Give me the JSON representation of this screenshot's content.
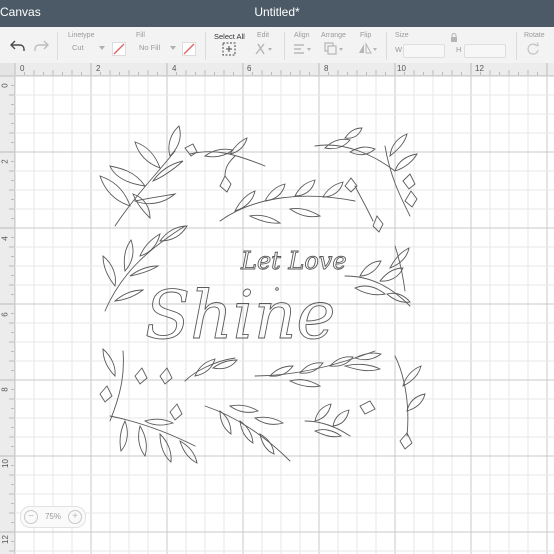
{
  "window": {
    "app_name": "Canvas",
    "doc_title": "Untitled*"
  },
  "toolbar": {
    "linetype_label": "Linetype",
    "linetype_value": "Cut",
    "fill_label": "Fill",
    "fill_value": "No Fill",
    "select_all_label": "Select All",
    "edit_label": "Edit",
    "align_label": "Align",
    "arrange_label": "Arrange",
    "flip_label": "Flip",
    "size_label": "Size",
    "width_label": "W",
    "height_label": "H",
    "rotate_label": "Rotate"
  },
  "ruler": {
    "top": [
      "0",
      "2",
      "4",
      "6",
      "8",
      "10",
      "12"
    ],
    "left": [
      "0",
      "2",
      "4",
      "6",
      "8",
      "10",
      "12"
    ]
  },
  "artwork": {
    "line1": "Let Love",
    "line2": "Shine",
    "stroke_color": "#5a5a5a"
  },
  "zoom": {
    "level": "75%",
    "minus": "−",
    "plus": "+"
  },
  "colors": {
    "titlebar": "#4b5a66",
    "grid_minor": "#e7e7e7",
    "grid_major": "#c9c9c9",
    "disabled_red": "#e06666"
  }
}
